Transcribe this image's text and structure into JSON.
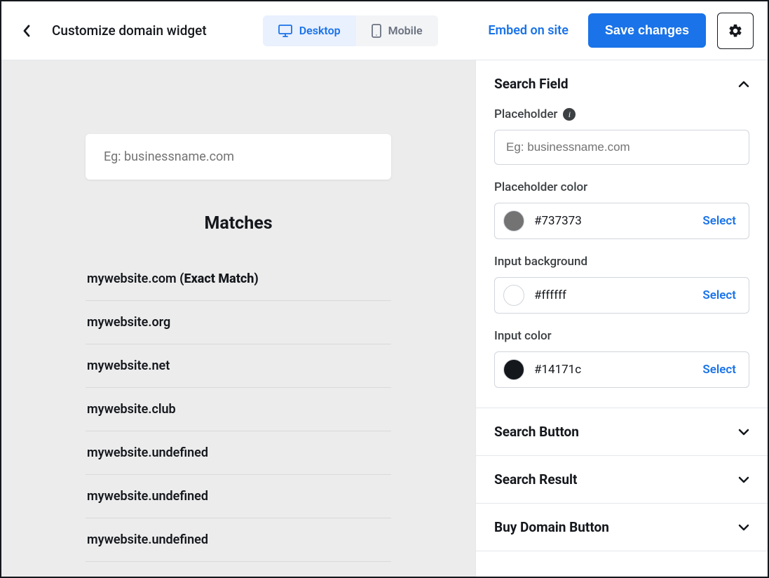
{
  "header": {
    "title": "Customize domain widget",
    "view_desktop": "Desktop",
    "view_mobile": "Mobile",
    "embed_label": "Embed on site",
    "save_label": "Save changes"
  },
  "preview": {
    "search_placeholder": "Eg: businessname.com",
    "matches_title": "Matches",
    "exact_match_suffix": "(Exact Match)",
    "results": [
      {
        "domain": "mywebsite.com",
        "exact": true
      },
      {
        "domain": "mywebsite.org",
        "exact": false
      },
      {
        "domain": "mywebsite.net",
        "exact": false
      },
      {
        "domain": "mywebsite.club",
        "exact": false
      },
      {
        "domain": "mywebsite.undefined",
        "exact": false
      },
      {
        "domain": "mywebsite.undefined",
        "exact": false
      },
      {
        "domain": "mywebsite.undefined",
        "exact": false
      }
    ]
  },
  "panel": {
    "search_field": {
      "title": "Search Field",
      "placeholder_label": "Placeholder",
      "placeholder_value": "Eg: businessname.com",
      "placeholder_color_label": "Placeholder color",
      "placeholder_color_value": "#737373",
      "input_bg_label": "Input background",
      "input_bg_value": "#ffffff",
      "input_color_label": "Input color",
      "input_color_value": "#14171c",
      "select_label": "Select"
    },
    "search_button_title": "Search Button",
    "search_result_title": "Search Result",
    "buy_button_title": "Buy Domain Button"
  }
}
